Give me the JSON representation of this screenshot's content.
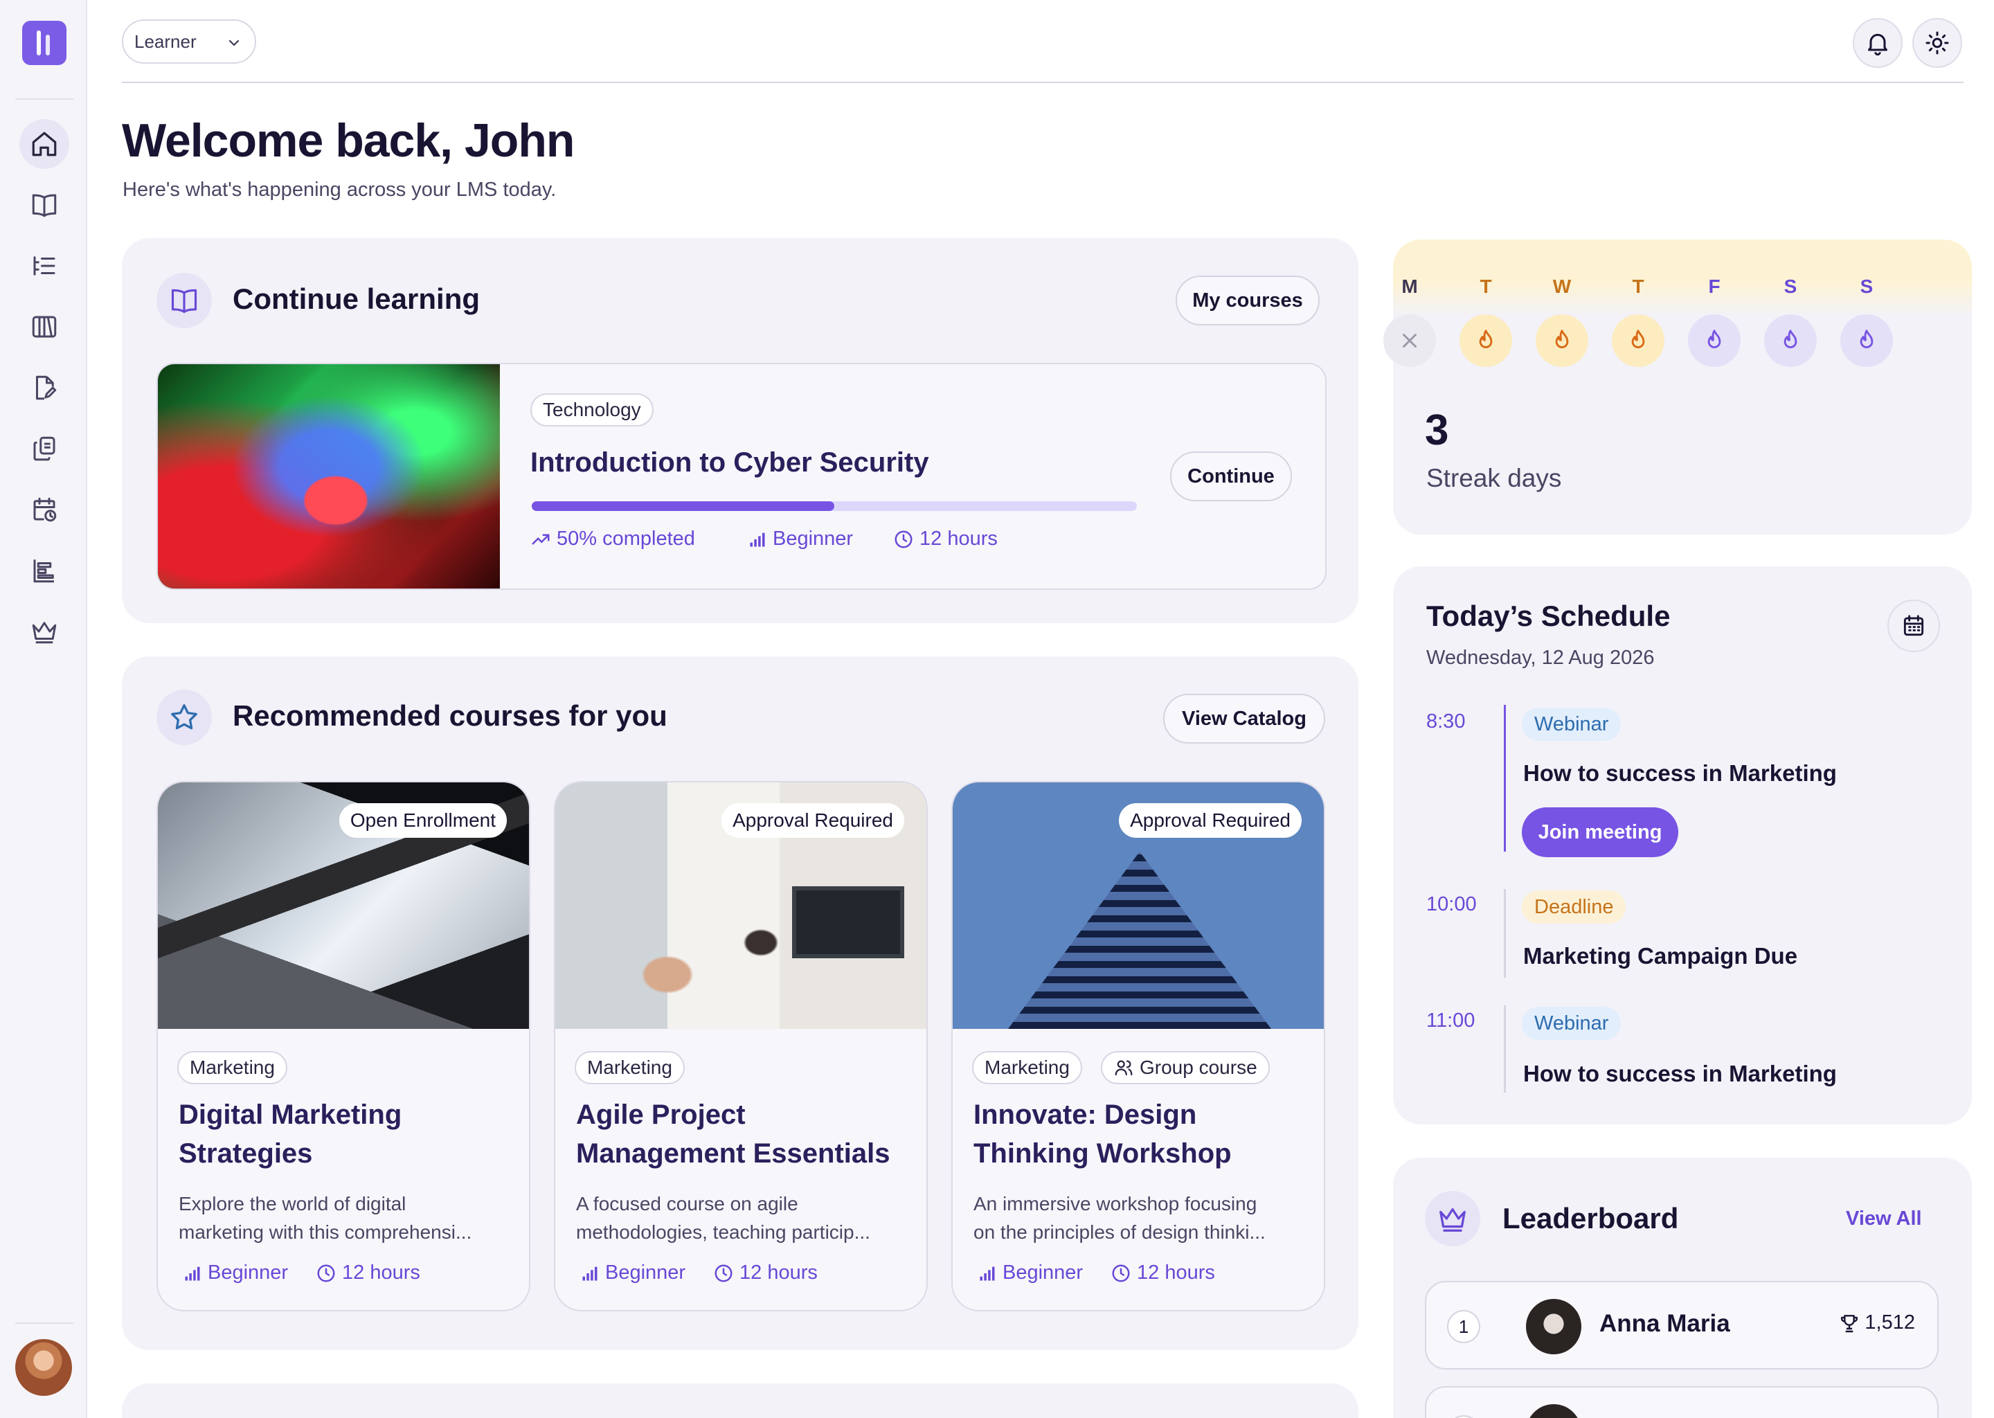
{
  "app": {
    "role_select": "Learner",
    "welcome_title": "Welcome back, John",
    "welcome_subtitle": "Here's what's happening across your LMS today."
  },
  "sidebar": {
    "items": [
      {
        "icon": "home-icon",
        "active": true
      },
      {
        "icon": "book-icon"
      },
      {
        "icon": "list-icon"
      },
      {
        "icon": "library-icon"
      },
      {
        "icon": "document-edit-icon"
      },
      {
        "icon": "copy-icon"
      },
      {
        "icon": "calendar-clock-icon"
      },
      {
        "icon": "bar-chart-icon"
      },
      {
        "icon": "crown-icon"
      }
    ]
  },
  "continue_learning": {
    "title": "Continue learning",
    "my_courses_label": "My courses",
    "course": {
      "category": "Technology",
      "title": "Introduction to Cyber Security",
      "progress_percent": 50,
      "progress_text": "50% completed",
      "level": "Beginner",
      "duration": "12 hours",
      "continue_label": "Continue"
    }
  },
  "recommended": {
    "title": "Recommended courses for you",
    "catalog_label": "View Catalog",
    "courses": [
      {
        "badge": "Open Enrollment",
        "category": "Marketing",
        "title_line1": "Digital Marketing",
        "title_line2": "Strategies",
        "desc_line1": "Explore the world of digital",
        "desc_line2": "marketing with this comprehensi...",
        "level": "Beginner",
        "duration": "12 hours"
      },
      {
        "badge": "Approval Required",
        "category": "Marketing",
        "title_line1": "Agile Project",
        "title_line2": "Management Essentials",
        "desc_line1": "A focused course on agile",
        "desc_line2": "methodologies, teaching particip...",
        "level": "Beginner",
        "duration": "12 hours"
      },
      {
        "badge": "Approval Required",
        "category": "Marketing",
        "extra_tag": "Group course",
        "title_line1": "Innovate: Design",
        "title_line2": "Thinking Workshop",
        "desc_line1": "An immersive workshop focusing",
        "desc_line2": "on the principles of design thinki...",
        "level": "Beginner",
        "duration": "12 hours"
      }
    ]
  },
  "streak": {
    "days": [
      "M",
      "T",
      "W",
      "T",
      "F",
      "S",
      "S"
    ],
    "count": "3",
    "label": "Streak days"
  },
  "schedule": {
    "title": "Today’s Schedule",
    "date": "Wednesday, 12 Aug 2026",
    "events": [
      {
        "time": "8:30",
        "type": "Webinar",
        "title": "How to success in Marketing",
        "action": "Join meeting"
      },
      {
        "time": "10:00",
        "type": "Deadline",
        "title": "Marketing Campaign Due"
      },
      {
        "time": "11:00",
        "type": "Webinar",
        "title": "How to success in Marketing"
      }
    ]
  },
  "leaderboard": {
    "title": "Leaderboard",
    "view_all": "View All",
    "rows": [
      {
        "rank": "1",
        "name": "Anna Maria",
        "score": "1,512"
      }
    ]
  },
  "colors": {
    "accent": "#7754e3",
    "panel_bg": "#f3f2f8",
    "title": "#1a1433",
    "flame_active_bg": "#fdecc0",
    "flame_active": "#d86a16",
    "flame_pending_bg": "#e4e0f7"
  }
}
